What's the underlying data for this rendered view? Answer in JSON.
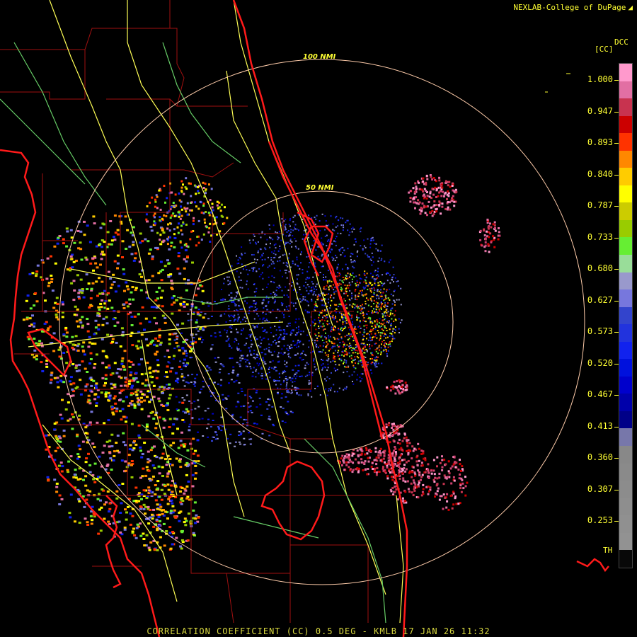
{
  "header": {
    "credit": "NEXLAB-College of DuPage",
    "credit_logo_icon": "cod-logo-icon"
  },
  "colorbar": {
    "label_top_right": "DCC",
    "label_top_left": "[CC]",
    "label_bottom": "TH",
    "ticks": [
      "1.000",
      "0.947",
      "0.893",
      "0.840",
      "0.787",
      "0.733",
      "0.680",
      "0.627",
      "0.573",
      "0.520",
      "0.467",
      "0.413",
      "0.360",
      "0.307",
      "0.253"
    ],
    "swatches": [
      "#ff99cc",
      "#e26fa3",
      "#c8334f",
      "#cc0000",
      "#ff3300",
      "#ff8800",
      "#ffcc00",
      "#ffff00",
      "#cccc00",
      "#99cc00",
      "#66ee33",
      "#99dd99",
      "#9999cc",
      "#7777dd",
      "#3344cc",
      "#2233dd",
      "#1122ee",
      "#0011dd",
      "#0000cc",
      "#0000aa",
      "#000088",
      "#7777aa",
      "#888888",
      "#8a8a8a",
      "#8c8c8c",
      "#8e8e8e",
      "#909090",
      "#929292",
      "#080808"
    ]
  },
  "range_rings": {
    "ring_100": "100 NMI",
    "ring_50": "50 NMI"
  },
  "footer": {
    "title": "CORRELATION COEFFICIENT (CC) 0.5 DEG - KMLB 17 JAN 26 11:32"
  },
  "colors": {
    "background": "#000000",
    "coastline": "#ff1a1a",
    "county": "#b01010",
    "roads": "#ffff55",
    "roads_secondary": "#66cc66",
    "ring": "#ffccaa",
    "label": "#ffff33"
  }
}
